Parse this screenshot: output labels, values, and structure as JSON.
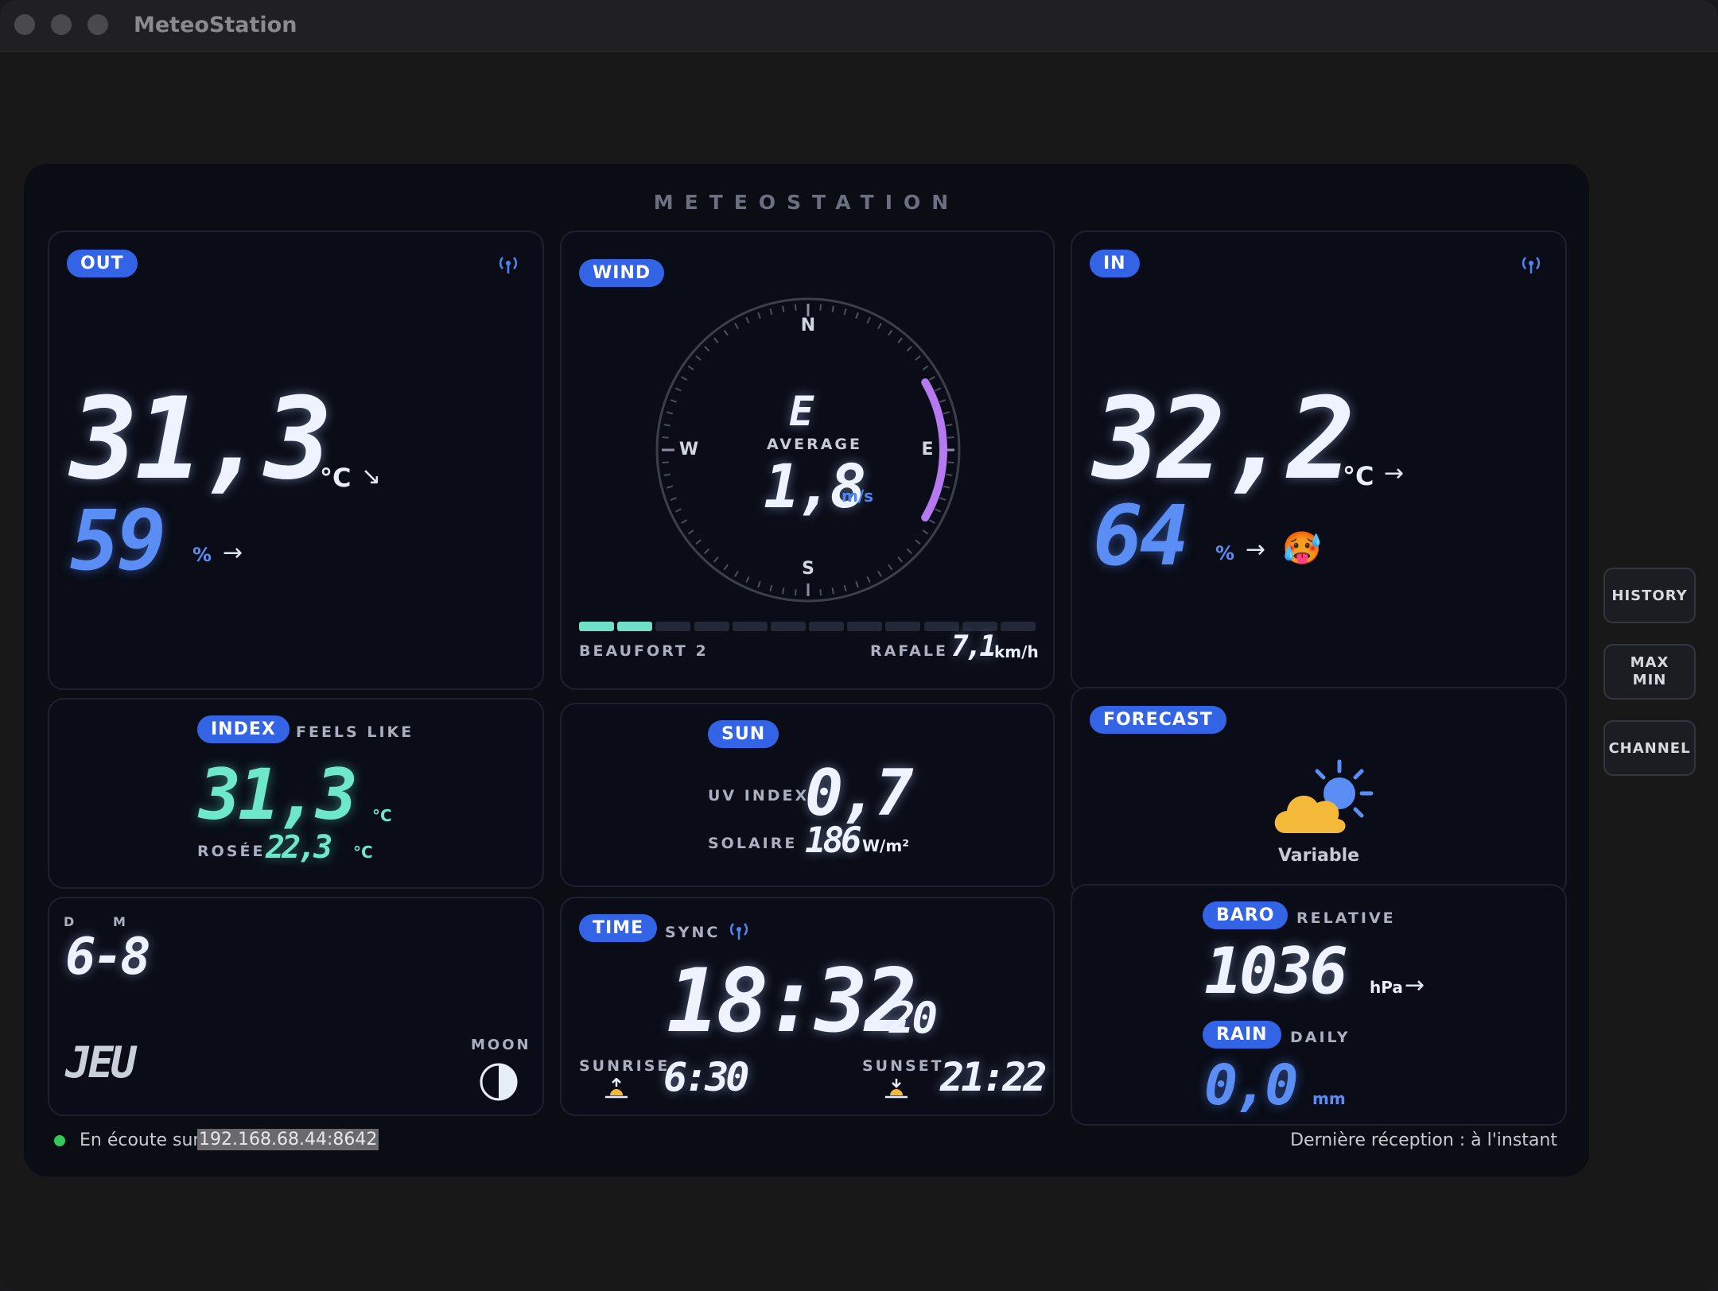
{
  "window": {
    "title": "MeteoStation"
  },
  "header": {
    "title": "METEOSTATION"
  },
  "outdoor": {
    "badge": "OUT",
    "temperature": "31,3",
    "temp_unit": "°C",
    "temp_trend": "↘",
    "humidity": "59",
    "hum_unit": "%",
    "hum_trend": "→"
  },
  "wind": {
    "badge": "WIND",
    "direction": "E",
    "average_label": "AVERAGE",
    "average": "1,8",
    "unit": "m/s",
    "compass": {
      "n": "N",
      "s": "S",
      "e": "E",
      "w": "W"
    },
    "beaufort_label": "BEAUFORT 2",
    "beaufort_level": 2,
    "beaufort_max": 12,
    "gust_label": "RAFALE",
    "gust": "7,1",
    "gust_unit": "km/h",
    "arc_color": "#b57af0",
    "beaufort_color": "#6fe0c8"
  },
  "indoor": {
    "badge": "IN",
    "temperature": "32,2",
    "temp_unit": "°C",
    "temp_trend": "→",
    "humidity": "64",
    "hum_unit": "%",
    "hum_trend": "→",
    "comfort_emoji": "🥵"
  },
  "index": {
    "badge": "INDEX",
    "label": "FEELS LIKE",
    "feels_like": "31,3",
    "unit": "°C",
    "dew_label": "ROSÉE",
    "dew": "22,3",
    "dew_unit": "°C"
  },
  "sun": {
    "badge": "SUN",
    "uv_label": "UV INDEX",
    "uv": "0,7",
    "solar_label": "SOLAIRE",
    "solar": "186",
    "solar_unit": "W/m²"
  },
  "forecast": {
    "badge": "FORECAST",
    "condition": "Variable",
    "icon": "partly-cloudy-icon"
  },
  "calendar": {
    "d_label": "D",
    "m_label": "M",
    "date": "6-8",
    "weekday": "JEU",
    "moon_label": "MOON"
  },
  "time": {
    "badge": "TIME",
    "sync_label": "SYNC",
    "clock": "18:32",
    "seconds": "20",
    "sunrise_label": "SUNRISE",
    "sunrise": "6:30",
    "sunset_label": "SUNSET",
    "sunset": "21:22"
  },
  "baro": {
    "badge": "BARO",
    "label": "RELATIVE",
    "value": "1036",
    "unit": "hPa",
    "trend": "→"
  },
  "rain": {
    "badge": "RAIN",
    "label": "DAILY",
    "value": "0,0",
    "unit": "mm"
  },
  "footer": {
    "listening_prefix": "En écoute sur",
    "address": "192.168.68.44:8642",
    "last_reception": "Dernière réception : à l'instant",
    "status_color": "#34c759"
  },
  "side_buttons": {
    "history": "HISTORY",
    "maxmin_line1": "MAX",
    "maxmin_line2": "MIN",
    "channel": "CHANNEL"
  }
}
